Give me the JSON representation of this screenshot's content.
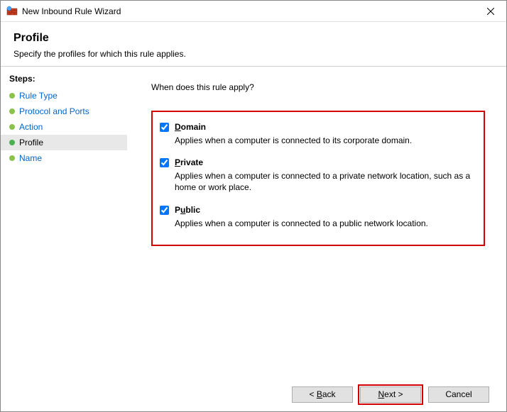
{
  "window": {
    "title": "New Inbound Rule Wizard"
  },
  "header": {
    "title": "Profile",
    "subtitle": "Specify the profiles for which this rule applies."
  },
  "sidebar": {
    "steps_label": "Steps:",
    "items": [
      {
        "label": "Rule Type",
        "current": false
      },
      {
        "label": "Protocol and Ports",
        "current": false
      },
      {
        "label": "Action",
        "current": false
      },
      {
        "label": "Profile",
        "current": true
      },
      {
        "label": "Name",
        "current": false
      }
    ]
  },
  "main": {
    "prompt": "When does this rule apply?",
    "options": [
      {
        "key": "domain",
        "label_pre": "",
        "mnemonic": "D",
        "label_post": "omain",
        "checked": true,
        "desc": "Applies when a computer is connected to its corporate domain."
      },
      {
        "key": "private",
        "label_pre": "",
        "mnemonic": "P",
        "label_post": "rivate",
        "checked": true,
        "desc": "Applies when a computer is connected to a private network location, such as a home or work place."
      },
      {
        "key": "public",
        "label_pre": "P",
        "mnemonic": "u",
        "label_post": "blic",
        "checked": true,
        "desc": "Applies when a computer is connected to a public network location."
      }
    ]
  },
  "footer": {
    "back_pre": "< ",
    "back_m": "B",
    "back_post": "ack",
    "next_pre": "",
    "next_m": "N",
    "next_post": "ext >",
    "cancel": "Cancel"
  }
}
